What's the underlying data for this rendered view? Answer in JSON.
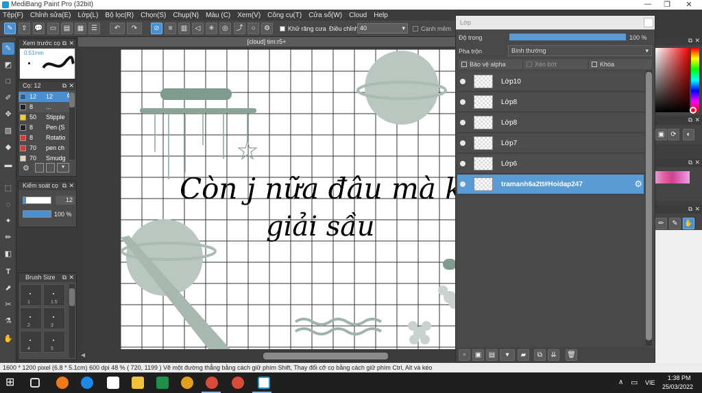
{
  "window": {
    "title": "MediBang Paint Pro (32bit)"
  },
  "menu": [
    "Tệp(F)",
    "Chỉnh sửa(E)",
    "Lớp(L)",
    "Bộ lọc(R)",
    "Chọn(S)",
    "Chụp(N)",
    "Màu (C)",
    "Xem(V)",
    "Công cụ(T)",
    "Cửa sổ(W)",
    "Cloud",
    "Help"
  ],
  "toolbar": {
    "antialias_label": "Khử răng cưa",
    "adjust_label": "Điều chỉnh",
    "adjust_value": "40",
    "edge_label": "Cạnh mềm"
  },
  "preview_panel": {
    "title": "Xem trước cọ",
    "size_text": "0.51mm"
  },
  "brush_panel": {
    "title": "Cọ: 12",
    "items": [
      {
        "size": "12",
        "name": "12",
        "color": "#2d5d8c"
      },
      {
        "size": "8",
        "name": "...",
        "color": "#202020"
      },
      {
        "size": "50",
        "name": "Stipple",
        "color": "#e8d21e"
      },
      {
        "size": "8",
        "name": "Pen (S",
        "color": "#202020"
      },
      {
        "size": "8",
        "name": "Rotatio",
        "color": "#d83a3a"
      },
      {
        "size": "70",
        "name": "pen ch",
        "color": "#d83a3a"
      },
      {
        "size": "70",
        "name": "Smudg",
        "color": "#e8d7c0"
      }
    ]
  },
  "brush_control": {
    "title": "Kiểm soát cọ",
    "size_value": "12",
    "opacity_value": "100 %",
    "opacity": 1.0
  },
  "brush_size_panel": {
    "title": "Brush Size",
    "sizes": [
      "1",
      "1.5",
      "2",
      "3",
      "4",
      "5"
    ]
  },
  "document": {
    "tab": "[cloud] tim:r5+",
    "line1": "Còn j nữa đâu mà k",
    "line2": "giải sầu"
  },
  "layer_panel": {
    "title": "Lớp",
    "opacity_label": "Độ trong",
    "opacity_value": "100 %",
    "opacity": 1.0,
    "blend_label": "Pha trộn",
    "blend_value": "Bình thường",
    "protect_alpha": "Bảo vệ alpha",
    "clip": "Xén bớt",
    "lock": "Khóa",
    "layers": [
      {
        "name": "Lớp10",
        "selected": false
      },
      {
        "name": "Lớp8",
        "selected": false
      },
      {
        "name": "Lớp8",
        "selected": false
      },
      {
        "name": "Lớp7",
        "selected": false
      },
      {
        "name": "Lớp6",
        "selected": false
      },
      {
        "name": "tramanh6a2tt#Hoidap247",
        "selected": true
      }
    ]
  },
  "status": {
    "text": "1600 * 1200 pixel  (6.8 * 5.1cm)  600 dpi  48 %  ( 720, 1199 )  Vẽ một đường thẳng bằng cách giữ phím Shift, Thay đổi cỡ cọ bằng cách giữ phím Ctrl, Alt và kéo"
  },
  "taskbar": {
    "lang": "VIE",
    "time": "1:38 PM",
    "date": "25/03/2022"
  },
  "colors": {
    "accent": "#4a8fd0",
    "selected_layer": "#5b9bd5",
    "sage": "#7f9b8d",
    "planet": "#b9c7c0"
  }
}
